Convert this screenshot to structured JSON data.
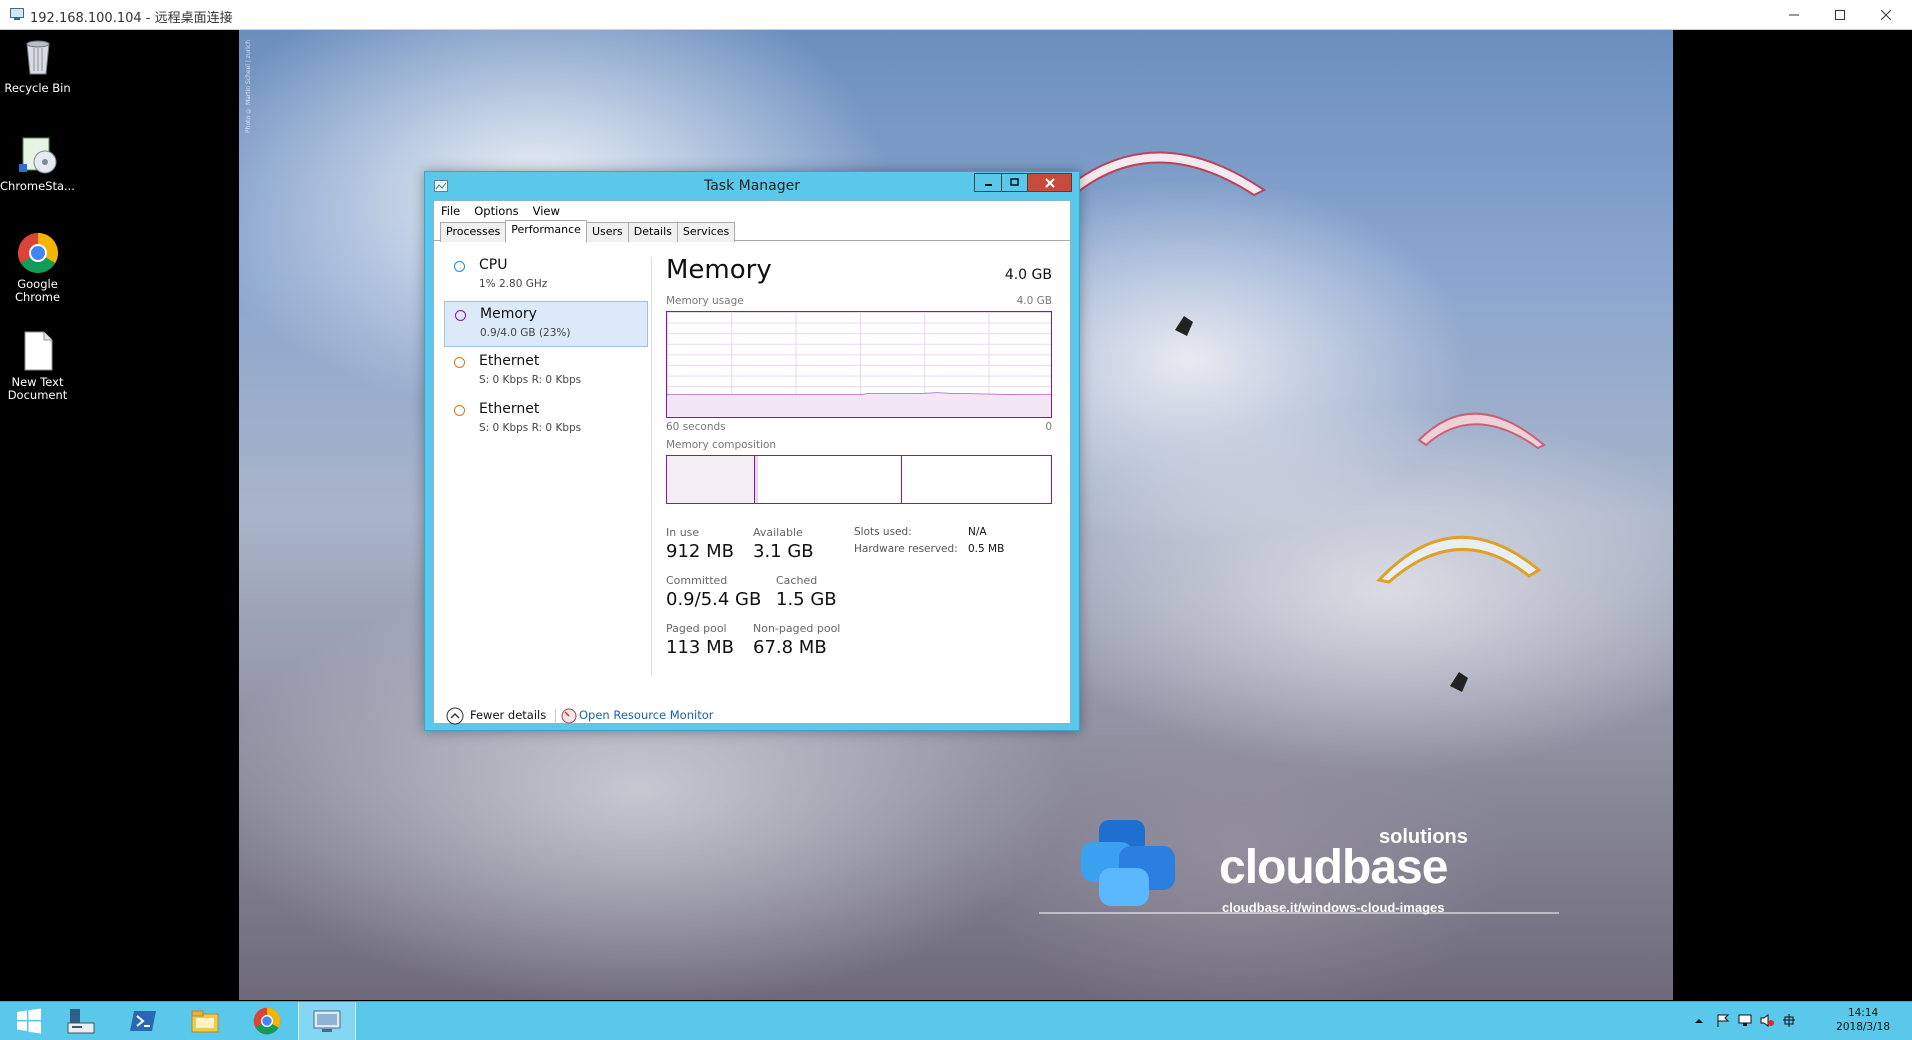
{
  "rdp": {
    "title": "192.168.100.104 - 远程桌面连接"
  },
  "desktop": {
    "icons": [
      {
        "label": "Recycle Bin"
      },
      {
        "label": "ChromeSta..."
      },
      {
        "label": "Google Chrome"
      },
      {
        "label": "New Text Document"
      }
    ],
    "wallpaper": {
      "brand_word": "cloudbase",
      "brand_solutions": "solutions",
      "brand_url": "cloudbase.it/windows-cloud-images",
      "credit": "Photo © Martin Scheel | zurich"
    }
  },
  "task_manager": {
    "title": "Task Manager",
    "menu": [
      "File",
      "Options",
      "View"
    ],
    "tabs": [
      "Processes",
      "Performance",
      "Users",
      "Details",
      "Services"
    ],
    "active_tab": "Performance",
    "sidebar": [
      {
        "name": "CPU",
        "sub": "1% 2.80 GHz",
        "color": "#1c8fd0"
      },
      {
        "name": "Memory",
        "sub": "0.9/4.0 GB (23%)",
        "color": "#8b12ae"
      },
      {
        "name": "Ethernet",
        "sub": "S: 0 Kbps R: 0 Kbps",
        "color": "#d27a1e"
      },
      {
        "name": "Ethernet",
        "sub": "S: 0 Kbps R: 0 Kbps",
        "color": "#d27a1e"
      }
    ],
    "selected_item": "Memory",
    "detail": {
      "title": "Memory",
      "total": "4.0 GB",
      "usage_label": "Memory usage",
      "usage_max": "4.0 GB",
      "time_left": "60 seconds",
      "time_right": "0",
      "composition_label": "Memory composition",
      "in_use_label": "In use",
      "in_use": "912 MB",
      "available_label": "Available",
      "available": "3.1 GB",
      "committed_label": "Committed",
      "committed": "0.9/5.4 GB",
      "cached_label": "Cached",
      "cached": "1.5 GB",
      "paged_label": "Paged pool",
      "paged": "113 MB",
      "nonpaged_label": "Non-paged pool",
      "nonpaged": "67.8 MB",
      "slots_label": "Slots used:",
      "slots": "N/A",
      "hw_reserved_label": "Hardware reserved:",
      "hw_reserved": "0.5 MB",
      "accent": "#8b12ae"
    },
    "footer": {
      "fewer": "Fewer details",
      "open_monitor": "Open Resource Monitor"
    }
  },
  "taskbar": {
    "apps": [
      "start-icon",
      "server-manager-icon",
      "powershell-icon",
      "file-explorer-icon",
      "chrome-icon",
      "remote-desktop-icon"
    ],
    "active_app": "remote-desktop-icon",
    "clock_time": "14:14",
    "clock_date": "2018/3/18"
  }
}
